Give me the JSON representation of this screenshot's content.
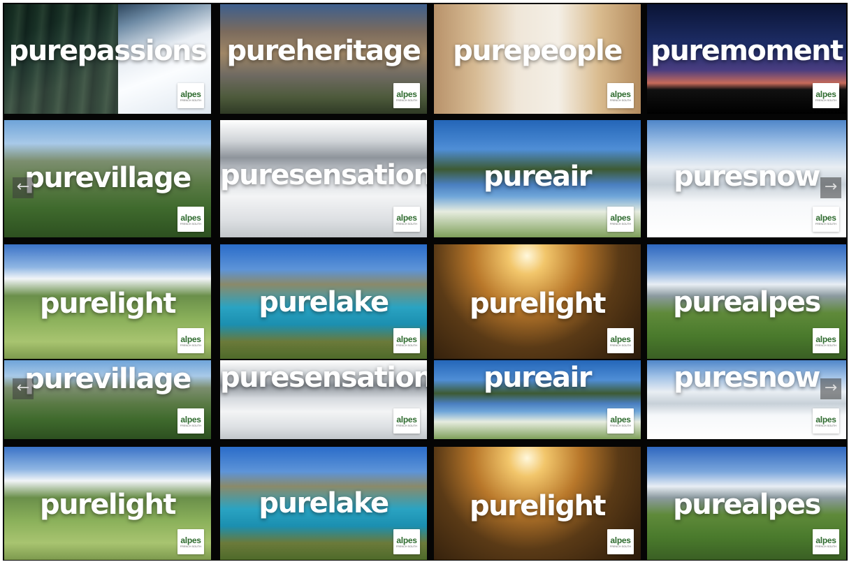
{
  "tiles": [
    {
      "title": "purepassions",
      "scene": "sc-snowforest",
      "logo": "alpes",
      "logo_sub": "French South"
    },
    {
      "title": "pureheritage",
      "scene": "sc-heritage",
      "logo": "alpes",
      "logo_sub": "French South"
    },
    {
      "title": "purepeople",
      "scene": "sc-people",
      "logo": "alpes",
      "logo_sub": "French South"
    },
    {
      "title": "puremoment",
      "scene": "sc-moment",
      "logo": "alpes",
      "logo_sub": "French South"
    },
    {
      "title": "purevillage",
      "scene": "sc-village",
      "logo": "alpes",
      "logo_sub": "French South"
    },
    {
      "title": "puresensation",
      "scene": "sc-sensation",
      "logo": "alpes",
      "logo_sub": "French South"
    },
    {
      "title": "pureair",
      "scene": "sc-air",
      "logo": "alpes",
      "logo_sub": "French South"
    },
    {
      "title": "puresnow",
      "scene": "sc-snow",
      "logo": "alpes",
      "logo_sub": "French South"
    },
    {
      "title": "purelight",
      "scene": "sc-light1",
      "logo": "alpes",
      "logo_sub": "French South"
    },
    {
      "title": "purelake",
      "scene": "sc-lake",
      "logo": "alpes",
      "logo_sub": "French South"
    },
    {
      "title": "purelight",
      "scene": "sc-light2",
      "logo": "alpes",
      "logo_sub": "French South"
    },
    {
      "title": "purealpes",
      "scene": "sc-alpes",
      "logo": "alpes",
      "logo_sub": "French South"
    },
    {
      "title": "purevillage",
      "scene": "sc-village",
      "logo": "alpes",
      "logo_sub": "French South"
    },
    {
      "title": "puresensation",
      "scene": "sc-sensation",
      "logo": "alpes",
      "logo_sub": "French South"
    },
    {
      "title": "pureair",
      "scene": "sc-air",
      "logo": "alpes",
      "logo_sub": "French South"
    },
    {
      "title": "puresnow",
      "scene": "sc-snow",
      "logo": "alpes",
      "logo_sub": "French South"
    },
    {
      "title": "purelight",
      "scene": "sc-light1",
      "logo": "alpes",
      "logo_sub": "French South"
    },
    {
      "title": "purelake",
      "scene": "sc-lake",
      "logo": "alpes",
      "logo_sub": "French South"
    },
    {
      "title": "purelight",
      "scene": "sc-light2",
      "logo": "alpes",
      "logo_sub": "French South"
    },
    {
      "title": "purealpes",
      "scene": "sc-alpes",
      "logo": "alpes",
      "logo_sub": "French South"
    }
  ],
  "nav": {
    "prev_glyph": "←",
    "next_glyph": "→"
  }
}
